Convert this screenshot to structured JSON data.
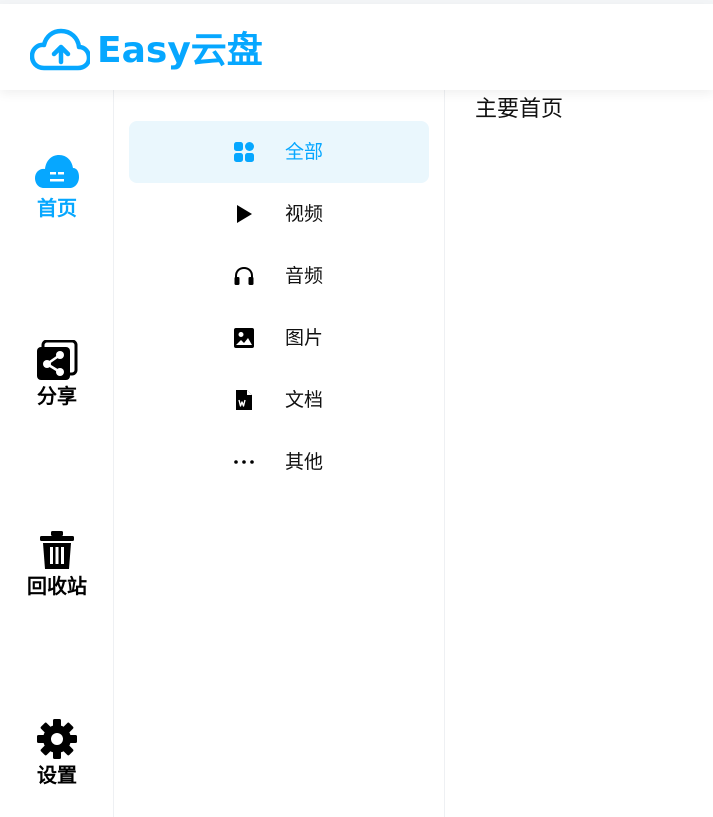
{
  "app": {
    "title": "Easy云盘",
    "brand_color": "#06a7ff"
  },
  "sidebar": {
    "items": [
      {
        "label": "首页",
        "icon": "cloud-icon",
        "active": true
      },
      {
        "label": "分享",
        "icon": "share-icon",
        "active": false
      },
      {
        "label": "回收站",
        "icon": "trash-icon",
        "active": false
      },
      {
        "label": "设置",
        "icon": "gear-icon",
        "active": false
      }
    ]
  },
  "subnav": {
    "items": [
      {
        "label": "全部",
        "icon": "grid-icon",
        "active": true
      },
      {
        "label": "视频",
        "icon": "play-icon",
        "active": false
      },
      {
        "label": "音频",
        "icon": "headphones-icon",
        "active": false
      },
      {
        "label": "图片",
        "icon": "image-icon",
        "active": false
      },
      {
        "label": "文档",
        "icon": "document-icon",
        "active": false
      },
      {
        "label": "其他",
        "icon": "more-icon",
        "active": false
      }
    ]
  },
  "main": {
    "title": "主要首页"
  }
}
